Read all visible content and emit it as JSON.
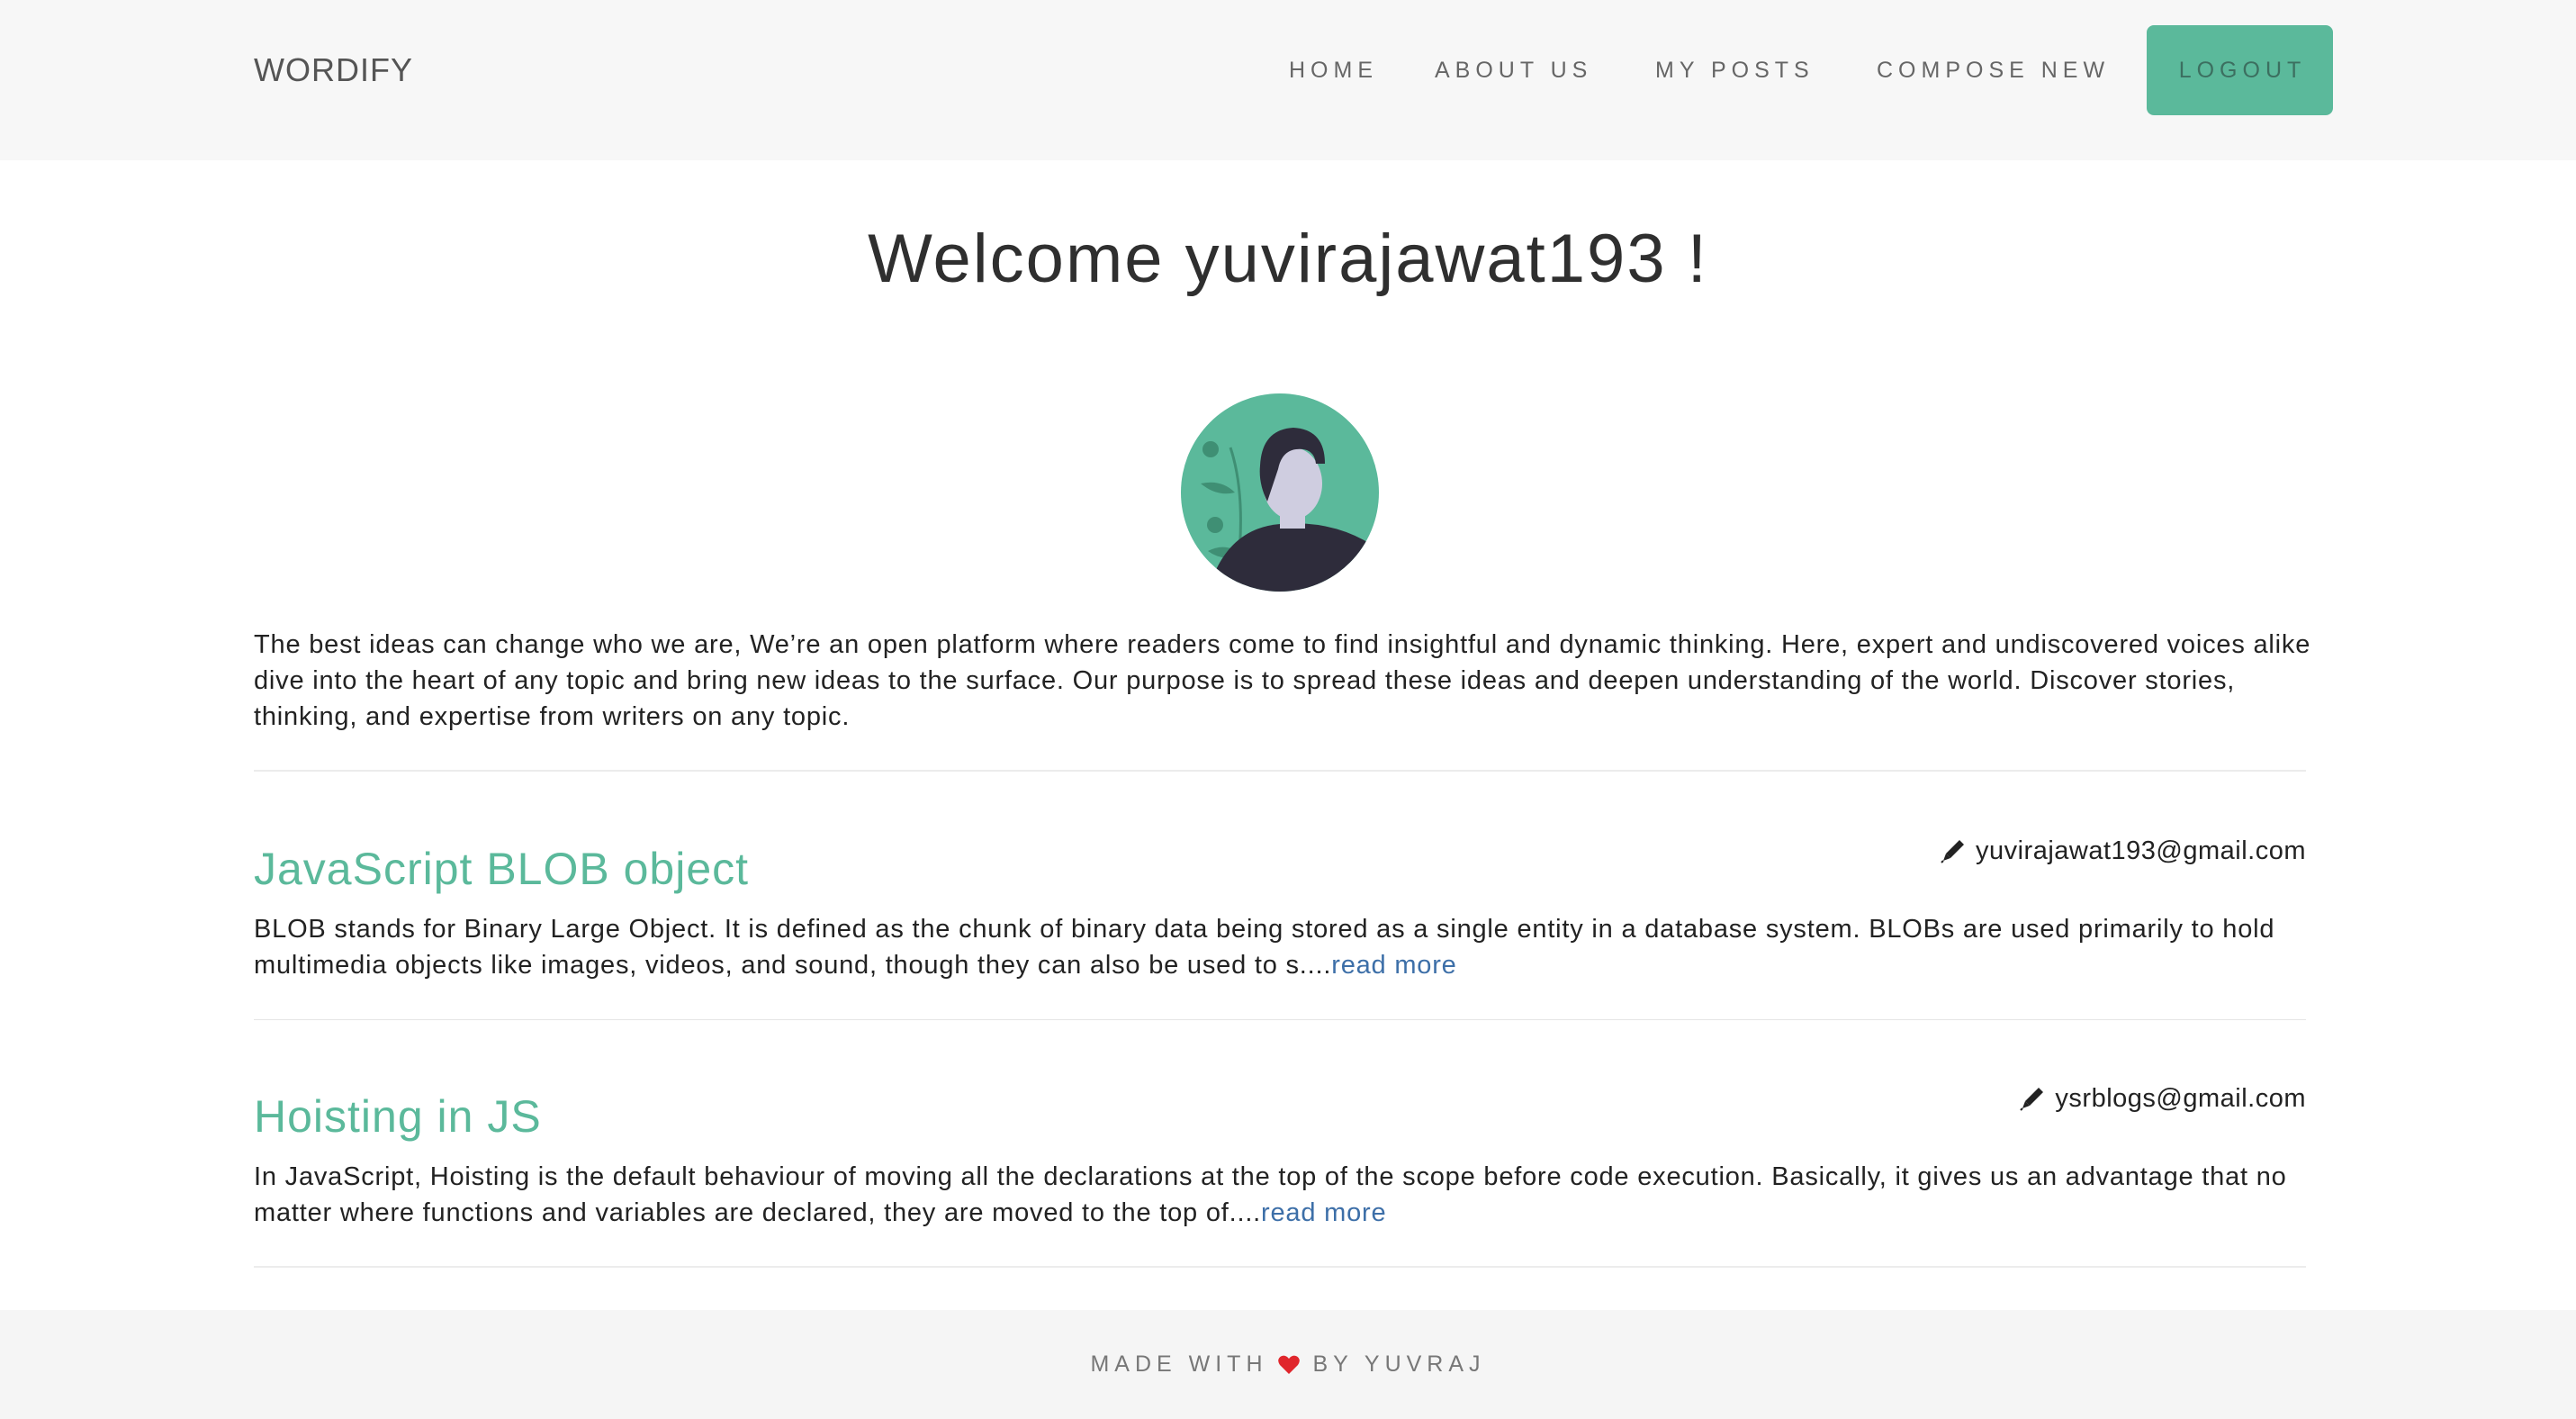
{
  "navbar": {
    "brand": "WORDIFY",
    "items": [
      {
        "label": "HOME"
      },
      {
        "label": "ABOUT US"
      },
      {
        "label": "MY POSTS"
      },
      {
        "label": "COMPOSE NEW"
      }
    ],
    "logout_label": "LOGOUT"
  },
  "main": {
    "title": "Welcome yuvirajawat193 !",
    "avatar_icon": "user-avatar-icon",
    "intro": "The best ideas can change who we are, We’re an open platform where readers come to find insightful and dynamic thinking. Here, expert and undiscovered voices alike dive into the heart of any topic and bring new ideas to the surface. Our purpose is to spread these ideas and deepen understanding of the world. Discover stories, thinking, and expertise from writers on any topic."
  },
  "posts": [
    {
      "title": "JavaScript BLOB object",
      "author": "yuvirajawat193@gmail.com",
      "excerpt": "BLOB stands for Binary Large Object. It is defined as the chunk of binary data being stored as a single entity in a database system. BLOBs are used primarily to hold multimedia objects like images, videos, and sound, though they can also be used to s....",
      "read_more": "read more"
    },
    {
      "title": "Hoisting in JS",
      "author": "ysrblogs@gmail.com",
      "excerpt": "In JavaScript, Hoisting is the default behaviour of moving all the declarations at the top of the scope before code execution. Basically, it gives us an advantage that no matter where functions and variables are declared, they are moved to the top of....",
      "read_more": "read more"
    }
  ],
  "footer": {
    "prefix": "MADE WITH",
    "suffix": "BY YUVRAJ",
    "heart_icon": "heart-icon"
  },
  "colors": {
    "accent": "#5bb99b",
    "link": "#3d6fa8",
    "navbar_bg": "#f7f7f7"
  }
}
